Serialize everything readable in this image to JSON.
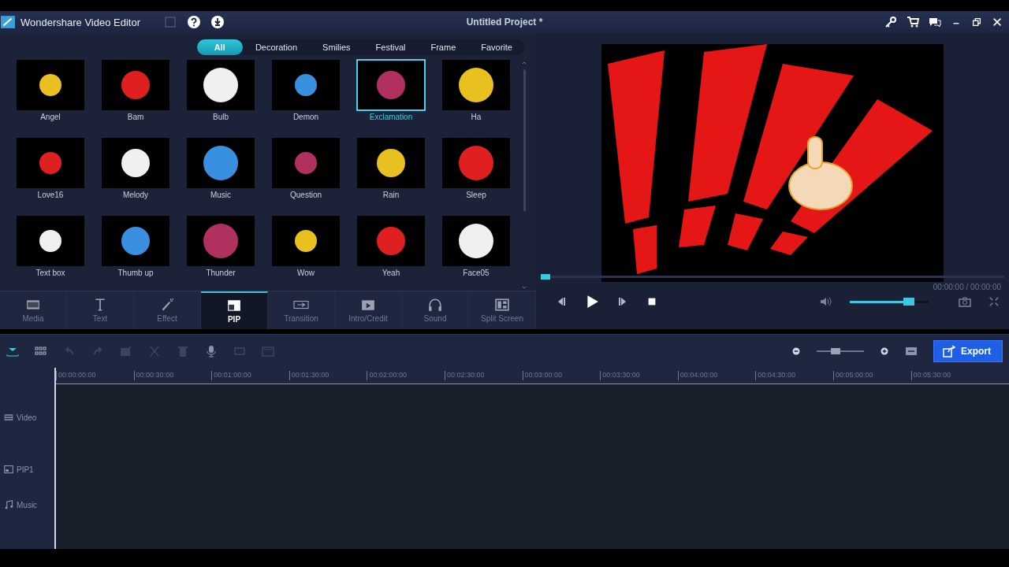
{
  "window": {
    "app_title": "Wondershare Video Editor",
    "project_title": "Untitled Project *"
  },
  "filters": [
    {
      "label": "All",
      "selected": true
    },
    {
      "label": "Decoration",
      "selected": false
    },
    {
      "label": "Smilies",
      "selected": false
    },
    {
      "label": "Festival",
      "selected": false
    },
    {
      "label": "Frame",
      "selected": false
    },
    {
      "label": "Favorite",
      "selected": false
    }
  ],
  "stickers": [
    {
      "label": "Angel",
      "selected": false
    },
    {
      "label": "Bam",
      "selected": false
    },
    {
      "label": "Bulb",
      "selected": false
    },
    {
      "label": "Demon",
      "selected": false
    },
    {
      "label": "Exclamation",
      "selected": true
    },
    {
      "label": "Ha",
      "selected": false
    },
    {
      "label": "Love16",
      "selected": false
    },
    {
      "label": "Melody",
      "selected": false
    },
    {
      "label": "Music",
      "selected": false
    },
    {
      "label": "Question",
      "selected": false
    },
    {
      "label": "Rain",
      "selected": false
    },
    {
      "label": "Sleep",
      "selected": false
    },
    {
      "label": "Text box",
      "selected": false
    },
    {
      "label": "Thumb up",
      "selected": false
    },
    {
      "label": "Thunder",
      "selected": false
    },
    {
      "label": "Wow",
      "selected": false
    },
    {
      "label": "Yeah",
      "selected": false
    },
    {
      "label": "Face05",
      "selected": false
    }
  ],
  "categories": [
    {
      "label": "Media",
      "selected": false
    },
    {
      "label": "Text",
      "selected": false
    },
    {
      "label": "Effect",
      "selected": false
    },
    {
      "label": "PIP",
      "selected": true
    },
    {
      "label": "Transition",
      "selected": false
    },
    {
      "label": "Intro/Credit",
      "selected": false
    },
    {
      "label": "Sound",
      "selected": false
    },
    {
      "label": "Split Screen",
      "selected": false
    }
  ],
  "player": {
    "progress": {
      "level": 0
    },
    "time": "00:00:00 / 00:00:00",
    "volume": {
      "level": 0.75
    }
  },
  "timeline": {
    "zoom": {
      "level": 0.4
    },
    "export_button": "Export",
    "ruler": [
      "00:00:00:00",
      "00:00:30:00",
      "00:01:00:00",
      "00:01:30:00",
      "00:02:00:00",
      "00:02:30:00",
      "00:03:00:00",
      "00:03:30:00",
      "00:04:00:00",
      "00:04:30:00",
      "00:05:00:00",
      "00:05:30:00"
    ],
    "tracks": [
      {
        "label": "Video",
        "kind": "video"
      },
      {
        "label": "PIP1",
        "kind": "pip"
      },
      {
        "label": "Music",
        "kind": "music"
      }
    ]
  }
}
